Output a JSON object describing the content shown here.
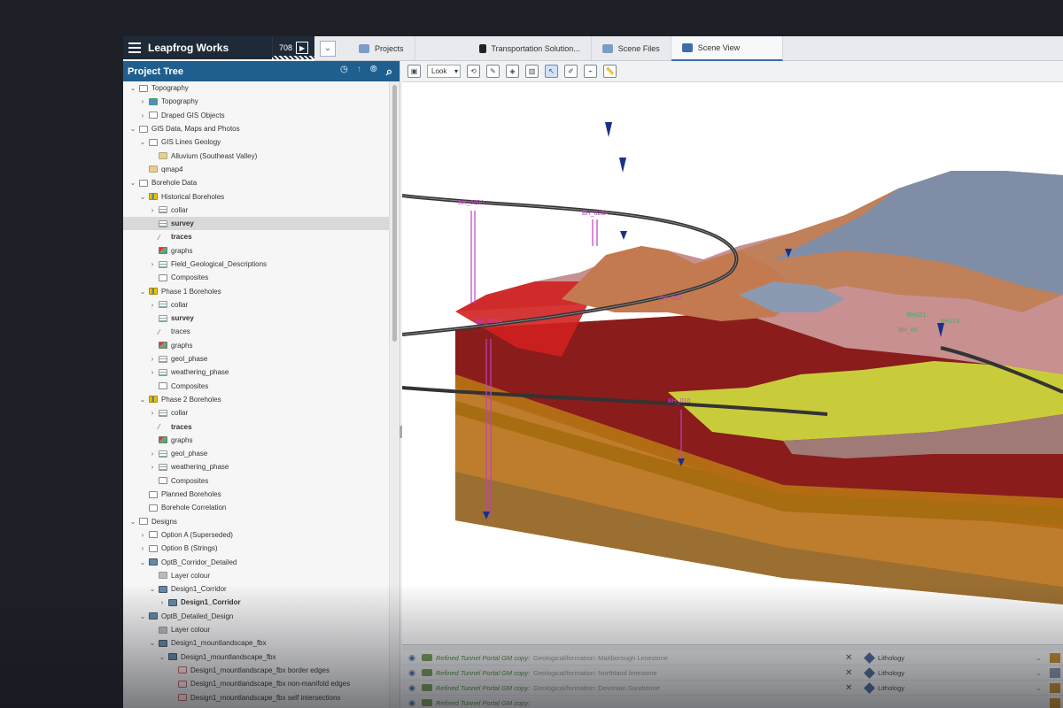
{
  "app": {
    "title": "Leapfrog Works",
    "task_count": "708"
  },
  "tabs": [
    {
      "label": "Projects"
    },
    {
      "label": "Transportation Solution..."
    },
    {
      "label": "Scene Files"
    },
    {
      "label": "Scene View"
    }
  ],
  "tree": {
    "header": "Project Tree",
    "items": [
      {
        "label": "Topography",
        "level": 0,
        "caret": "open",
        "icon": "folder"
      },
      {
        "label": "Topography",
        "level": 1,
        "caret": "closed",
        "icon": "topo"
      },
      {
        "label": "Draped GIS Objects",
        "level": 1,
        "caret": "closed",
        "icon": "folder"
      },
      {
        "label": "GIS Data, Maps and Photos",
        "level": 0,
        "caret": "open",
        "icon": "folder"
      },
      {
        "label": "GIS Lines Geology",
        "level": 1,
        "caret": "open",
        "icon": "folder"
      },
      {
        "label": "Alluvium (Southeast Valley)",
        "level": 2,
        "caret": "none",
        "icon": "gis"
      },
      {
        "label": "qmap4",
        "level": 1,
        "caret": "none",
        "icon": "gis"
      },
      {
        "label": "Borehole Data",
        "level": 0,
        "caret": "open",
        "icon": "folder"
      },
      {
        "label": "Historical Boreholes",
        "level": 1,
        "caret": "open",
        "icon": "boreholes"
      },
      {
        "label": "collar",
        "level": 2,
        "caret": "closed",
        "icon": "table"
      },
      {
        "label": "survey",
        "level": 2,
        "caret": "none",
        "icon": "table",
        "bold": true,
        "selected": true
      },
      {
        "label": "traces",
        "level": 2,
        "caret": "none",
        "icon": "trace",
        "bold": true
      },
      {
        "label": "graphs",
        "level": 2,
        "caret": "none",
        "icon": "graph"
      },
      {
        "label": "Field_Geological_Descriptions",
        "level": 2,
        "caret": "closed",
        "icon": "table"
      },
      {
        "label": "Composites",
        "level": 2,
        "caret": "none",
        "icon": "folder"
      },
      {
        "label": "Phase 1 Boreholes",
        "level": 1,
        "caret": "open",
        "icon": "boreholes"
      },
      {
        "label": "collar",
        "level": 2,
        "caret": "closed",
        "icon": "table"
      },
      {
        "label": "survey",
        "level": 2,
        "caret": "none",
        "icon": "table",
        "bold": true
      },
      {
        "label": "traces",
        "level": 2,
        "caret": "none",
        "icon": "trace"
      },
      {
        "label": "graphs",
        "level": 2,
        "caret": "none",
        "icon": "graph"
      },
      {
        "label": "geol_phase",
        "level": 2,
        "caret": "closed",
        "icon": "table"
      },
      {
        "label": "weathering_phase",
        "level": 2,
        "caret": "closed",
        "icon": "table"
      },
      {
        "label": "Composites",
        "level": 2,
        "caret": "none",
        "icon": "folder"
      },
      {
        "label": "Phase 2 Boreholes",
        "level": 1,
        "caret": "open",
        "icon": "boreholes"
      },
      {
        "label": "collar",
        "level": 2,
        "caret": "closed",
        "icon": "table"
      },
      {
        "label": "traces",
        "level": 2,
        "caret": "none",
        "icon": "trace",
        "bold": true
      },
      {
        "label": "graphs",
        "level": 2,
        "caret": "none",
        "icon": "graph"
      },
      {
        "label": "geol_phase",
        "level": 2,
        "caret": "closed",
        "icon": "table"
      },
      {
        "label": "weathering_phase",
        "level": 2,
        "caret": "closed",
        "icon": "table"
      },
      {
        "label": "Composites",
        "level": 2,
        "caret": "none",
        "icon": "folder"
      },
      {
        "label": "Planned Boreholes",
        "level": 1,
        "caret": "none",
        "icon": "folder"
      },
      {
        "label": "Borehole Correlation",
        "level": 1,
        "caret": "none",
        "icon": "folder"
      },
      {
        "label": "Designs",
        "level": 0,
        "caret": "open",
        "icon": "folder"
      },
      {
        "label": "Option A (Superseded)",
        "level": 1,
        "caret": "closed",
        "icon": "folder"
      },
      {
        "label": "Option B (Strings)",
        "level": 1,
        "caret": "closed",
        "icon": "folder"
      },
      {
        "label": "OptB_Corridor_Detailed",
        "level": 1,
        "caret": "open",
        "icon": "design"
      },
      {
        "label": "Layer colour",
        "level": 2,
        "caret": "none",
        "icon": "layer"
      },
      {
        "label": "Design1_Corridor",
        "level": 2,
        "caret": "open",
        "icon": "design"
      },
      {
        "label": "Design1_Corridor",
        "level": 3,
        "caret": "closed",
        "icon": "design",
        "bold": true
      },
      {
        "label": "OptB_Detailed_Design",
        "level": 1,
        "caret": "open",
        "icon": "design"
      },
      {
        "label": "Layer colour",
        "level": 2,
        "caret": "none",
        "icon": "layer"
      },
      {
        "label": "Design1_mountlandscape_fbx",
        "level": 2,
        "caret": "open",
        "icon": "design"
      },
      {
        "label": "Design1_mountlandscape_fbx",
        "level": 3,
        "caret": "open",
        "icon": "design"
      },
      {
        "label": "Design1_mountlandscape_fbx border edges",
        "level": 4,
        "caret": "none",
        "icon": "edge"
      },
      {
        "label": "Design1_mountlandscape_fbx non-manifold edges",
        "level": 4,
        "caret": "none",
        "icon": "edge"
      },
      {
        "label": "Design1_mountlandscape_fbx self intersections",
        "level": 4,
        "caret": "none",
        "icon": "edge"
      }
    ]
  },
  "scene_toolbar": {
    "look_label": "Look"
  },
  "boreholes": [
    {
      "label": "BH_029A"
    },
    {
      "label": "BH_026A"
    },
    {
      "label": "BH_035A"
    },
    {
      "label": "BH_012"
    },
    {
      "label": "BH_010"
    },
    {
      "label": "BH221"
    },
    {
      "label": "BH223"
    },
    {
      "label": "BH_06"
    }
  ],
  "shape_list": [
    {
      "name": "Refined Tunnel Portal GM copy:",
      "detail": "Geological/formation: Marlborough Limestone",
      "property": "Lithology",
      "swatch": "#c9902a"
    },
    {
      "name": "Refined Tunnel Portal GM copy:",
      "detail": "Geological/formation: Northland limestone",
      "property": "Lithology",
      "swatch": "#8898b0"
    },
    {
      "name": "Refined Tunnel Portal GM copy:",
      "detail": "Geological/formation: Devonian Sandstone",
      "property": "Lithology",
      "swatch": "#c9902a"
    },
    {
      "name": "Refined Tunnel Portal GM copy:",
      "detail": "",
      "property": "",
      "swatch": "#c9902a"
    }
  ],
  "colors": {
    "header_blue": "#1e5f8f",
    "title_dark": "#1f2a38",
    "rock_red": "#b02020",
    "rock_orange": "#c08030",
    "rock_pink": "#c89090",
    "rock_grey": "#8898b0",
    "rock_yellow": "#d0d040"
  }
}
